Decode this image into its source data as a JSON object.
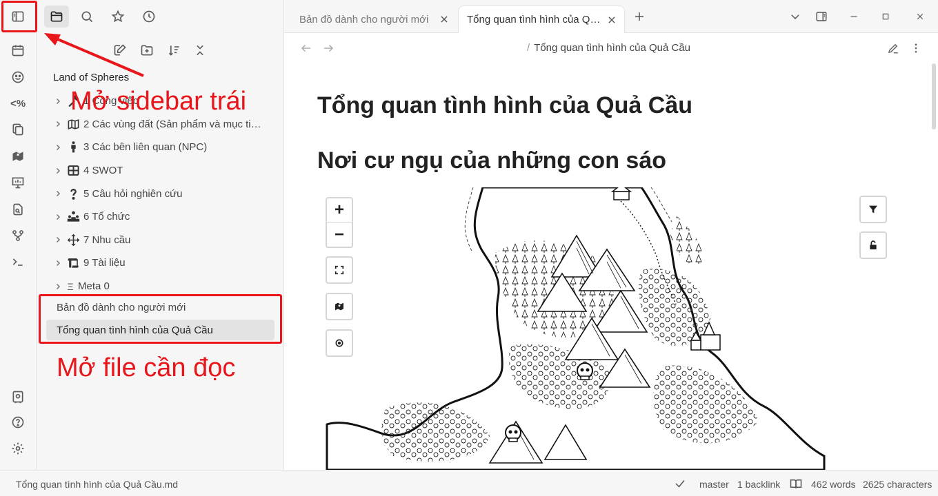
{
  "ribbon": {
    "icons": [
      "sidebar-toggle-icon",
      "calendar-icon",
      "smiley-icon",
      "percent-code-icon",
      "copy-icon",
      "map-icon",
      "presentation-icon",
      "file-search-icon",
      "graph-icon",
      "terminal-icon",
      "vault-icon",
      "help-icon",
      "settings-icon"
    ],
    "percent_code_text": "<%"
  },
  "sidebar": {
    "tabs": [
      "files-icon",
      "search-icon",
      "star-icon",
      "clock-icon"
    ],
    "vault_name": "Land of Spheres",
    "tree": [
      {
        "label": "1 Công việc",
        "icon": "hammer-icon"
      },
      {
        "label": "2 Các vùng đất (Sản phẩm và mục tiêu)",
        "icon": "map-icon"
      },
      {
        "label": "3 Các bên liên quan (NPC)",
        "icon": "person-icon"
      },
      {
        "label": "4 SWOT",
        "icon": "grid-icon"
      },
      {
        "label": "5 Câu hỏi nghiên cứu",
        "icon": "question-icon"
      },
      {
        "label": "6 Tổ chức",
        "icon": "organization-icon"
      },
      {
        "label": "7 Nhu cầu",
        "icon": "move-icon"
      },
      {
        "label": "9 Tài liệu",
        "icon": "scroll-icon"
      },
      {
        "label": "Meta 0",
        "icon": "xi-icon"
      }
    ],
    "files": [
      {
        "label": "Bản đồ dành cho người mới",
        "active": false
      },
      {
        "label": "Tổng quan tình hình của Quả Cầu",
        "active": true
      }
    ]
  },
  "annotations": {
    "open_sidebar": "Mở sidebar trái",
    "open_file": "Mở file cần đọc",
    "color": "#e8161b"
  },
  "tabs": [
    {
      "label": "Bản đồ dành cho người mới",
      "active": false
    },
    {
      "label": "Tổng quan tình hình của Quả Cầu",
      "active": true
    }
  ],
  "view": {
    "breadcrumb_sep": "/",
    "title": "Tổng quan tình hình của Quả Cầu"
  },
  "content": {
    "h1": "Tổng quan tình hình của Quả Cầu",
    "h2": "Nơi cư ngụ của những con sáo",
    "map_controls": {
      "zoom_in": "+",
      "zoom_out": "−"
    }
  },
  "status": {
    "filename": "Tổng quan tình hình của Quả Cầu.md",
    "branch": "master",
    "backlinks": "1 backlink",
    "words": "462 words",
    "characters": "2625 characters"
  }
}
